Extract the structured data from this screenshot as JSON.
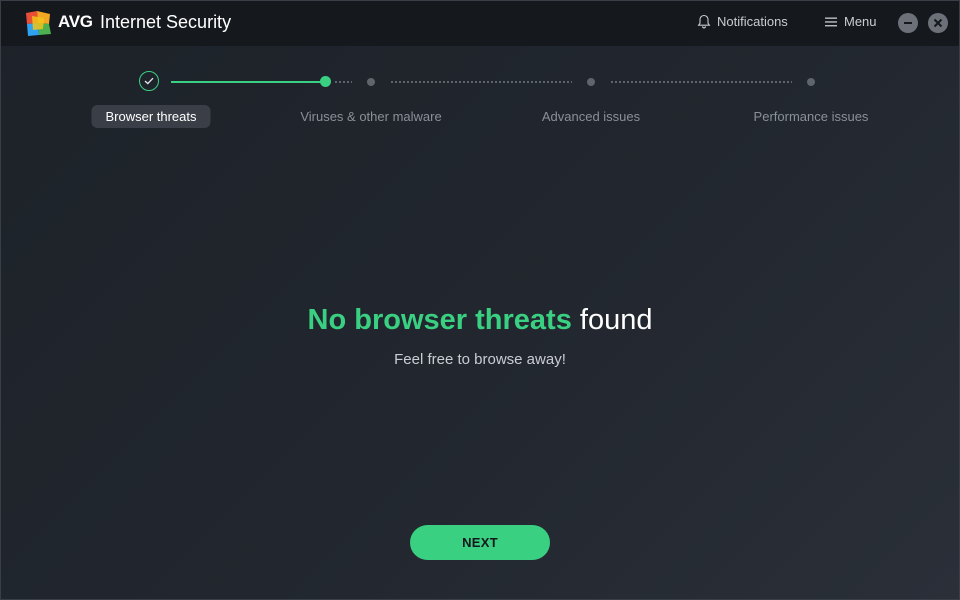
{
  "app": {
    "brand": "AVG",
    "product": "Internet Security"
  },
  "titlebar": {
    "notifications_label": "Notifications",
    "menu_label": "Menu"
  },
  "stepper": {
    "steps": [
      {
        "label": "Browser threats",
        "state": "done"
      },
      {
        "label": "Viruses & other malware",
        "state": "active"
      },
      {
        "label": "Advanced issues",
        "state": "pending"
      },
      {
        "label": "Performance issues",
        "state": "pending"
      }
    ]
  },
  "result": {
    "headline_accent": "No browser threats",
    "headline_rest": "found",
    "subline": "Feel free to browse away!"
  },
  "actions": {
    "next_label": "NEXT"
  },
  "colors": {
    "accent": "#3ad082",
    "background": "#1f242b",
    "titlebar": "#15191e"
  }
}
